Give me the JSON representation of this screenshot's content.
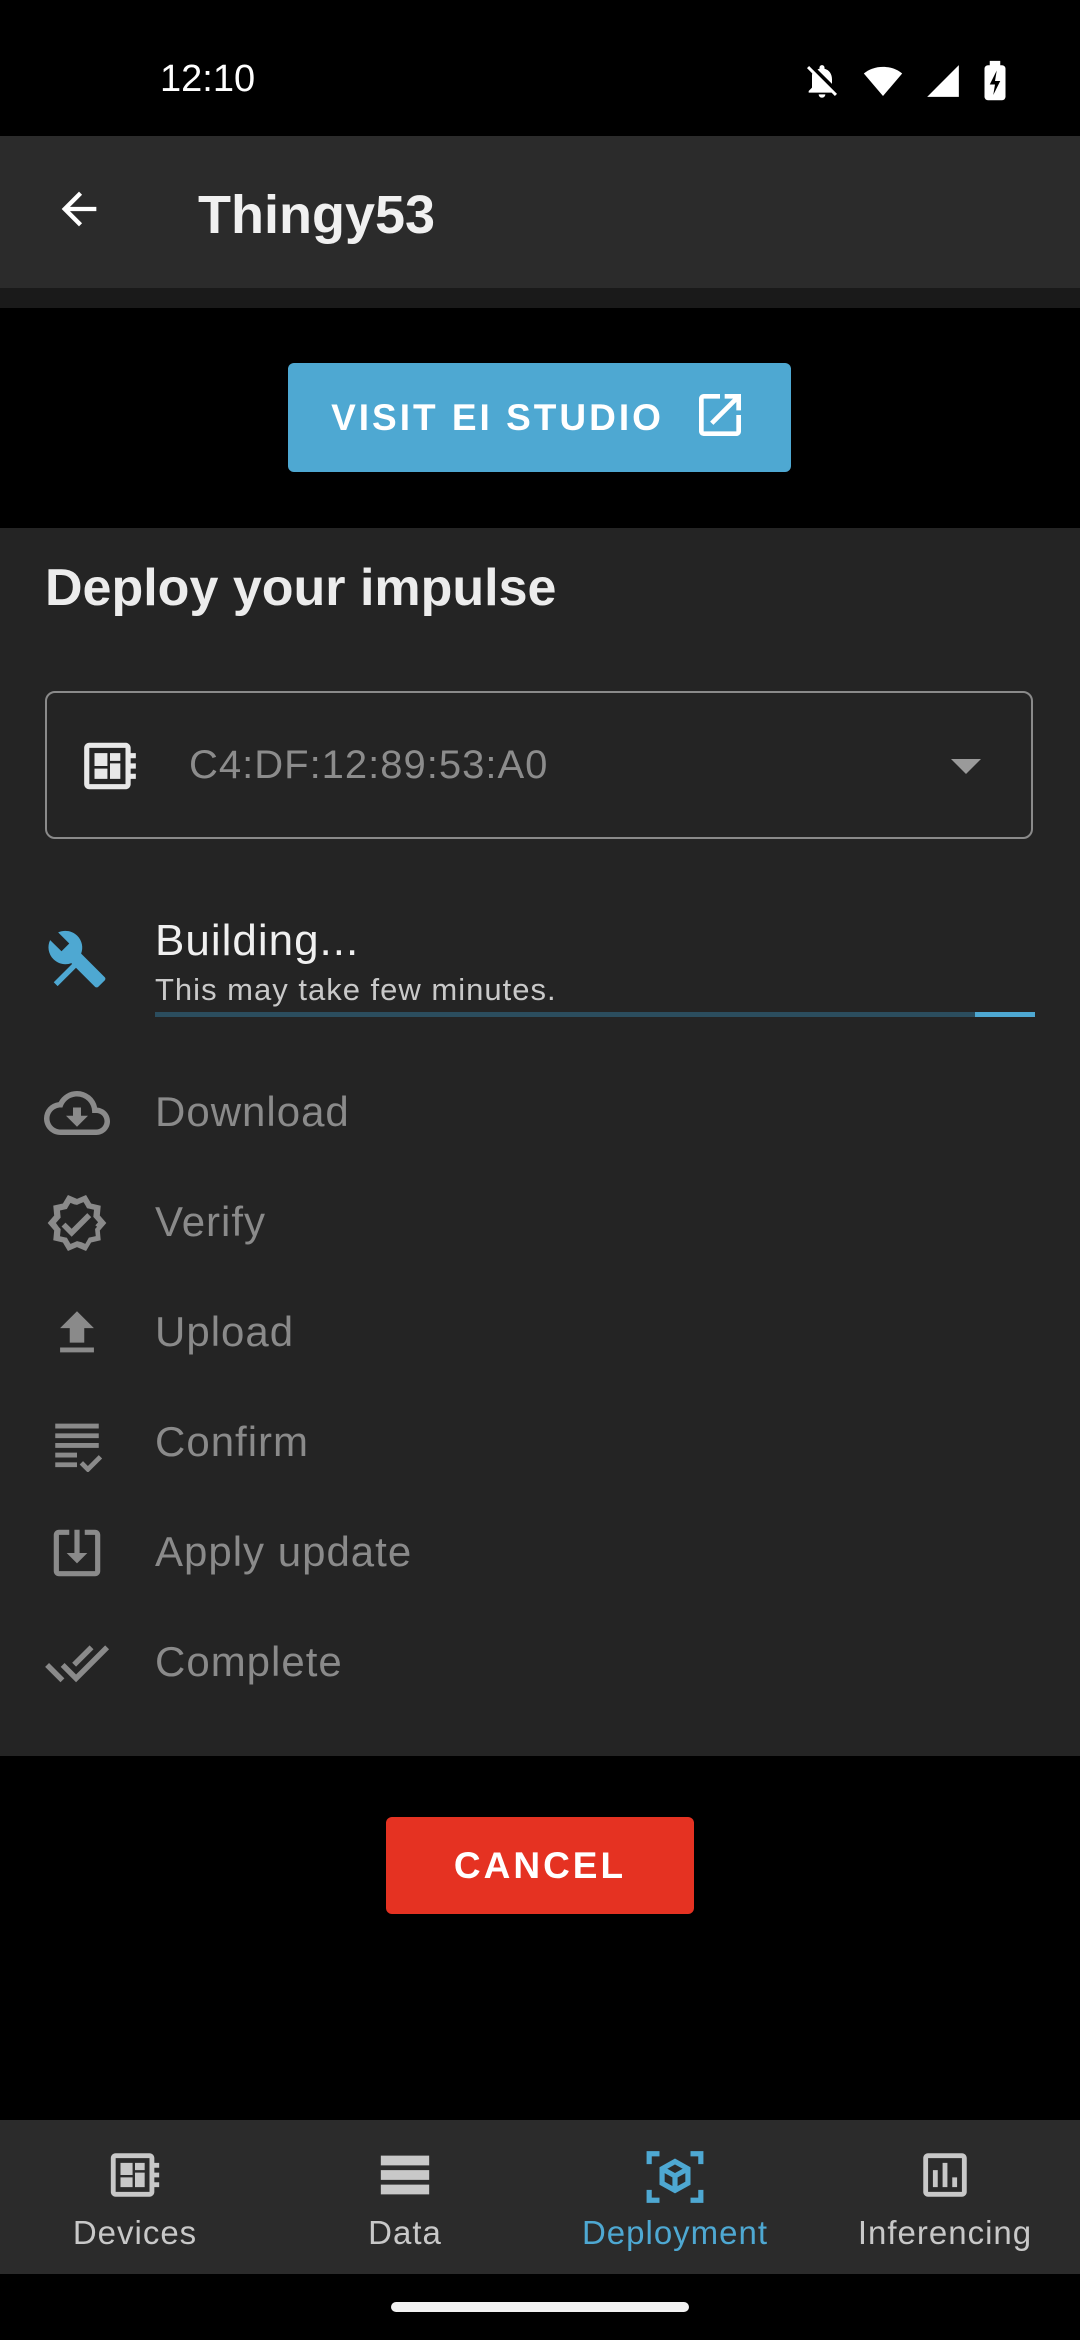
{
  "status_bar": {
    "time": "12:10",
    "icons": [
      "notifications-off-icon",
      "wifi-icon",
      "signal-icon",
      "battery-charging-icon"
    ]
  },
  "app_bar": {
    "title": "Thingy53",
    "back_icon": "arrow-back-icon"
  },
  "visit_button": {
    "label": "VISIT EI STUDIO",
    "icon": "open-in-new-icon"
  },
  "deploy": {
    "title": "Deploy your impulse",
    "device_select": {
      "value": "C4:DF:12:89:53:A0",
      "icon": "developer-board-icon"
    },
    "steps": [
      {
        "label": "Building...",
        "sublabel": "This may take few minutes.",
        "icon": "build-icon",
        "state": "active",
        "progress": 0.07
      },
      {
        "label": "Download",
        "icon": "cloud-download-icon",
        "state": "pending"
      },
      {
        "label": "Verify",
        "icon": "verified-icon",
        "state": "pending"
      },
      {
        "label": "Upload",
        "icon": "upload-icon",
        "state": "pending"
      },
      {
        "label": "Confirm",
        "icon": "checklist-icon",
        "state": "pending"
      },
      {
        "label": "Apply update",
        "icon": "system-update-icon",
        "state": "pending"
      },
      {
        "label": "Complete",
        "icon": "done-all-icon",
        "state": "pending"
      }
    ]
  },
  "cancel_button": {
    "label": "CANCEL"
  },
  "bottom_nav": {
    "items": [
      {
        "label": "Devices",
        "icon": "developer-board-icon",
        "active": false
      },
      {
        "label": "Data",
        "icon": "storage-icon",
        "active": false
      },
      {
        "label": "Deployment",
        "icon": "deployment-cube-icon",
        "active": true
      },
      {
        "label": "Inferencing",
        "icon": "bar-chart-icon",
        "active": false
      }
    ]
  },
  "colors": {
    "accent": "#4ea8d2",
    "cancel": "#e53222",
    "surface": "#242424",
    "app_bar": "#2b2b2b",
    "background": "#000000"
  }
}
